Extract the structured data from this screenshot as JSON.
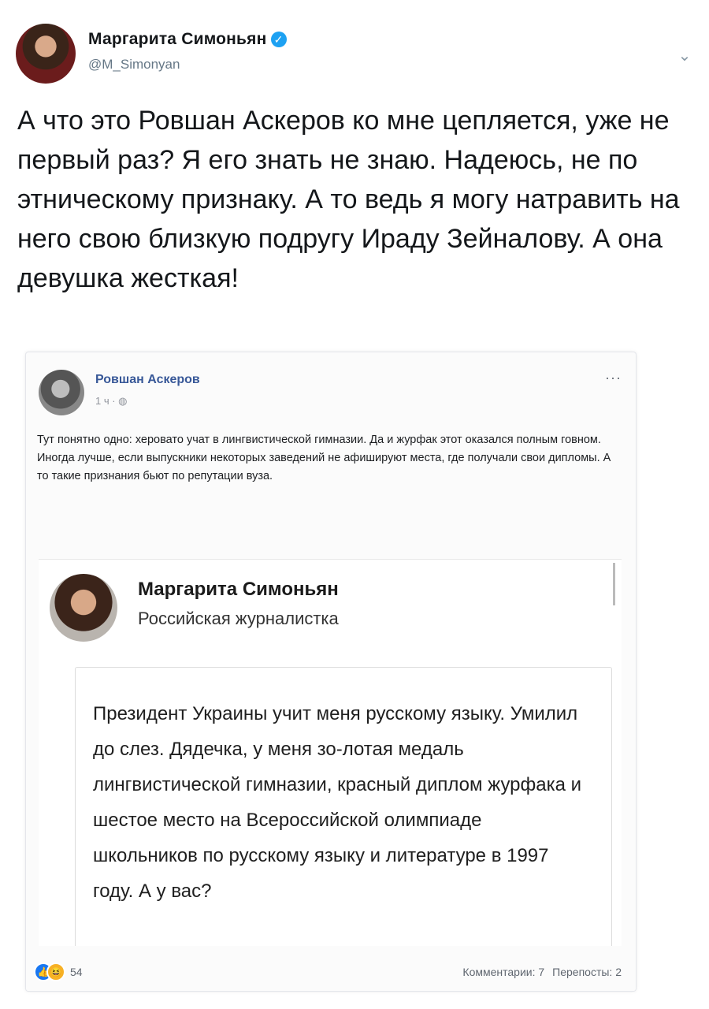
{
  "tweet": {
    "author_name": "Маргарита Симоньян",
    "handle": "@M_Simonyan",
    "text": "А что это Ровшан Аскеров ко мне цепляется, уже не первый раз? Я его знать не знаю. Надеюсь, не по этническому признаку. А то ведь я могу натравить на него свою близкую подругу Ираду Зейналову. А она девушка жесткая!",
    "verified_glyph": "✓",
    "caret_glyph": "⌄",
    "icons": {
      "verified": "verified-badge-icon",
      "caret": "chevron-down-icon"
    },
    "colors": {
      "accent": "#1da1f2",
      "text": "#14171a",
      "muted": "#657786"
    }
  },
  "embed": {
    "fb_author": "Ровшан Аскеров",
    "fb_time": "1 ч · ",
    "fb_privacy_glyph": "◍",
    "fb_more_glyph": "···",
    "fb_body_p1": "Тут понятно одно: херовато учат в лингвистической гимназии. Да и журфак этот оказался полным говном.",
    "fb_body_p2": "Иногда лучше, если выпускники некоторых заведений не афишируют места, где получали свои дипломы. А то такие признания бьют по репутации вуза.",
    "card_name": "Маргарита Симоньян",
    "card_subtitle": "Российская журналистка",
    "quote": "Президент Украины учит меня русскому языку. Умилил до слез. Дядечка, у меня зо-лотая медаль лингвистической гимназии, красный диплом журфака и шестое место на Всероссийской олимпиаде школьников по русскому языку и литературе в 1997 году. А у вас?",
    "reactions": {
      "like_glyph": "👍",
      "haha_glyph": "😆",
      "count": "54"
    },
    "comments": "Комментарии: 7",
    "shares": "Перепосты: 2",
    "colors": {
      "fb_link": "#385898",
      "like": "#1877f2",
      "haha": "#f7b125"
    }
  }
}
